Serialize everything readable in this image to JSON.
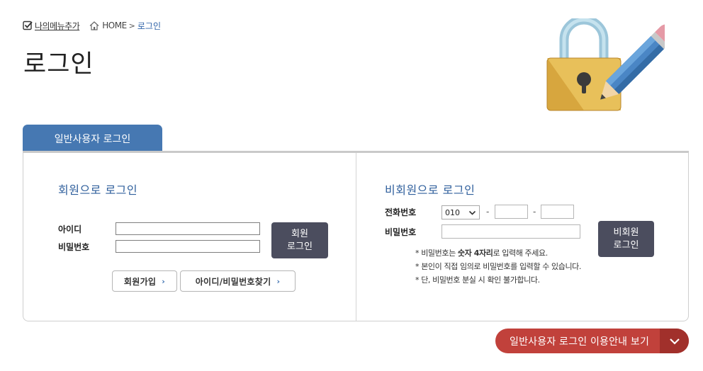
{
  "topbar": {
    "my_menu_label": "나의메뉴추가",
    "breadcrumb_home": "HOME",
    "breadcrumb_sep": ">",
    "breadcrumb_current": "로그인"
  },
  "page_title": "로그인",
  "tab_label": "일반사용자 로그인",
  "member": {
    "title": "회원으로 로그인",
    "id_label": "아이디",
    "pw_label": "비밀번호",
    "id_value": "",
    "pw_value": "",
    "login_line1": "회원",
    "login_line2": "로그인",
    "join_label": "회원가입",
    "find_label": "아이디/비밀번호찾기",
    "arrow": "›"
  },
  "nonmember": {
    "title": "비회원으로 로그인",
    "phone_label": "전화번호",
    "phone_prefix": "010",
    "phone_dash": "-",
    "phone_mid": "",
    "phone_last": "",
    "pw_label": "비밀번호",
    "pw_value": "",
    "login_line1": "비회원",
    "login_line2": "로그인",
    "notes": [
      {
        "pre": "* 비밀번호는 ",
        "bold": "숫자 4자리",
        "post": "로 입력해 주세요."
      },
      {
        "pre": "* 본인이 직접 임의로 비밀번호를 입력할 수 있습니다.",
        "bold": "",
        "post": ""
      },
      {
        "pre": "* 단, 비밀번호 분실 시 확인 불가합니다.",
        "bold": "",
        "post": ""
      }
    ]
  },
  "guide_button_label": "일반사용자 로그인 이용안내 보기",
  "colors": {
    "tab": "#4678b2",
    "section_title": "#2f5f9c",
    "login_button": "#4b4d5e",
    "guide_button": "#c1413b",
    "guide_arrow_bg": "#a1302b"
  }
}
